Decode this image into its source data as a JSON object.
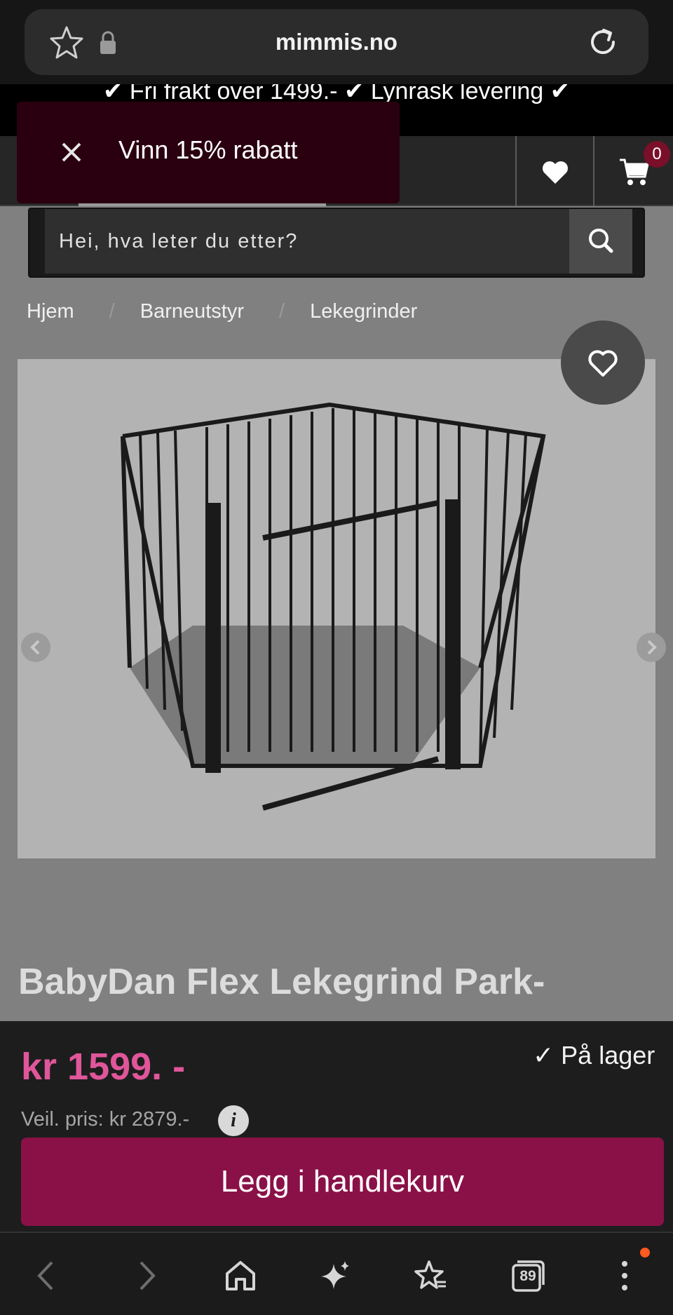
{
  "browser": {
    "url": "mimmis.no",
    "tabs_count": "89"
  },
  "header": {
    "promo_text": "✔ Fri frakt over 1499.- ✔ Lynrask levering ✔",
    "cart_count": "0"
  },
  "toast": {
    "text": "Vinn 15% rabatt"
  },
  "search": {
    "placeholder": "Hei, hva leter du etter?"
  },
  "breadcrumb": {
    "items": [
      "Hjem",
      "Barneutstyr",
      "Lekegrinder"
    ],
    "separator": "/"
  },
  "product": {
    "title": "BabyDan Flex Lekegrind Park-",
    "price": "kr 1599. -",
    "stock": "✓ På lager",
    "recommended_price": "Veil. pris: kr 2879.-",
    "add_to_cart_label": "Legg i handlekurv",
    "image_icon": "playpen-image"
  },
  "colors": {
    "accent_pink": "#e0569a",
    "cta": "#8a1148",
    "toast_bg": "#2a0010"
  }
}
